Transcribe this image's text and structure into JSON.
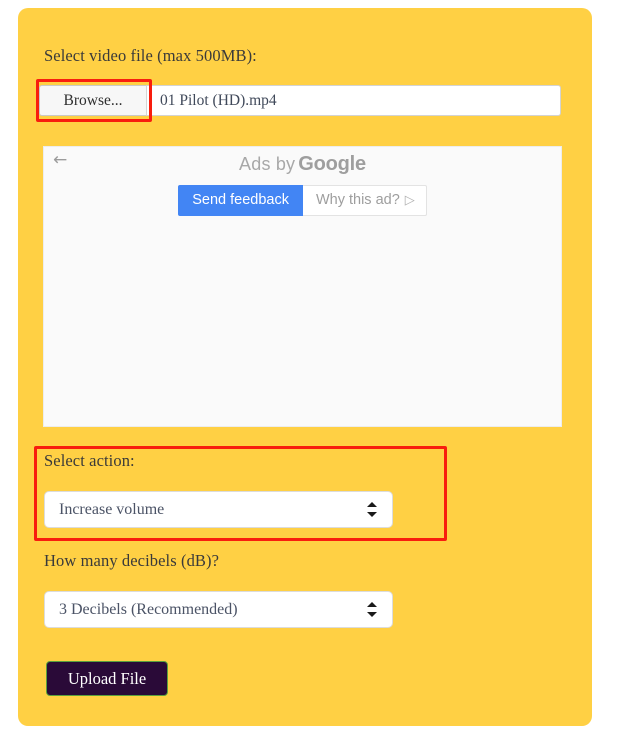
{
  "card": {
    "background_color": "#FFD044"
  },
  "file_field": {
    "label": "Select video file (max 500MB):",
    "browse_button_label": "Browse...",
    "file_name": "01 Pilot (HD).mp4",
    "highlighted": true,
    "highlight_color": "#f81d0e"
  },
  "ad_block": {
    "back_icon": "←",
    "ads_by_prefix": "Ads by",
    "ads_by_brand": "Google",
    "send_feedback_label": "Send feedback",
    "why_this_ad_label": "Why this ad?",
    "why_this_ad_glyph": "▷",
    "send_feedback_color": "#4285f4"
  },
  "action_field": {
    "label": "Select action:",
    "selected_value": "Increase volume",
    "highlighted": true,
    "highlight_color": "#f81d0e"
  },
  "decibels_field": {
    "label": "How many decibels (dB)?",
    "selected_value": "3 Decibels (Recommended)"
  },
  "submit": {
    "label": "Upload File",
    "background_color": "#2a0a38",
    "border_color": "#5aa03c"
  }
}
